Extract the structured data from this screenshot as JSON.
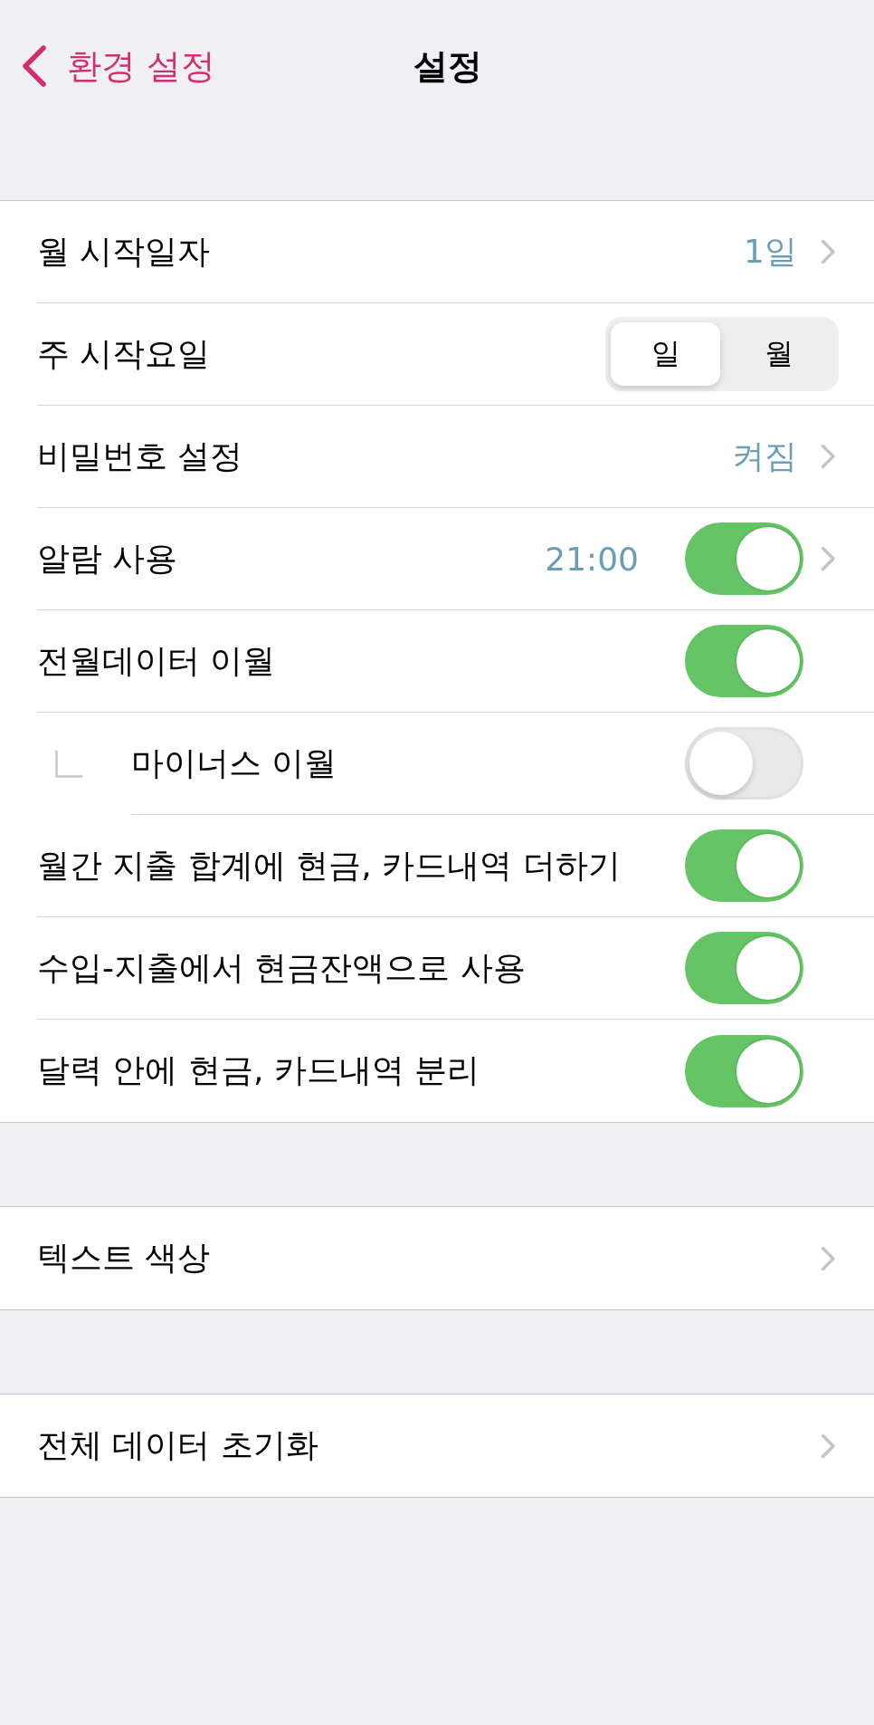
{
  "nav": {
    "back_label": "환경 설정",
    "title": "설정"
  },
  "sections": [
    {
      "rows": [
        {
          "kind": "value",
          "label": "월 시작일자",
          "value": "1일",
          "chevron": true
        },
        {
          "kind": "segmented",
          "label": "주 시작요일",
          "chevron": false,
          "segments": [
            {
              "label": "일",
              "selected": true
            },
            {
              "label": "월",
              "selected": false
            }
          ]
        },
        {
          "kind": "value",
          "label": "비밀번호 설정",
          "value": "켜짐",
          "chevron": true
        },
        {
          "kind": "toggle",
          "label": "알람 사용",
          "value": "21:00",
          "on": true,
          "chevron": true
        },
        {
          "kind": "toggle",
          "label": "전월데이터 이월",
          "on": true,
          "chevron": false,
          "children": [
            {
              "kind": "toggle",
              "label": "마이너스 이월",
              "on": false,
              "chevron": false
            }
          ]
        },
        {
          "kind": "toggle",
          "label": "월간 지출 합계에 현금, 카드내역 더하기",
          "on": true,
          "chevron": false
        },
        {
          "kind": "toggle",
          "label": "수입-지출에서 현금잔액으로 사용",
          "on": true,
          "chevron": false
        },
        {
          "kind": "toggle",
          "label": "달력 안에 현금, 카드내역 분리",
          "on": true,
          "chevron": false
        }
      ]
    },
    {
      "rows": [
        {
          "kind": "link",
          "label": "텍스트 색상",
          "chevron": true
        }
      ]
    },
    {
      "rows": [
        {
          "kind": "link",
          "label": "전체 데이터 초기화",
          "chevron": true
        }
      ]
    }
  ]
}
